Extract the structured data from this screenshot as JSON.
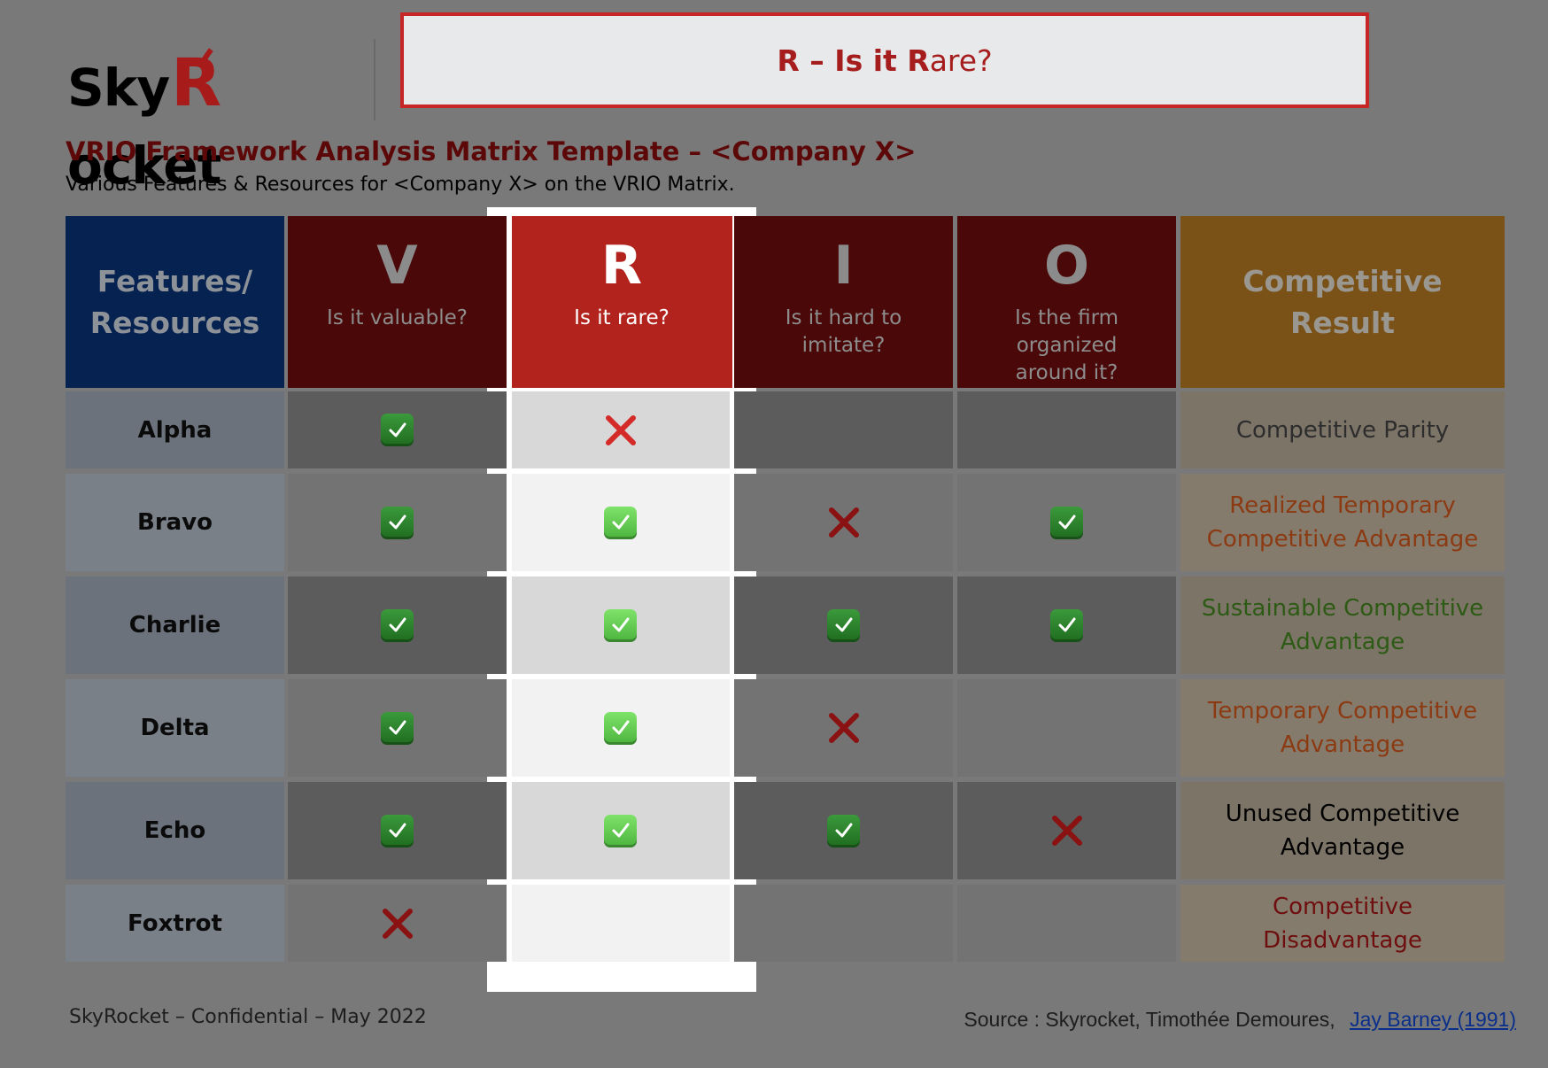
{
  "logo": {
    "pre": "Sky",
    "r": "R",
    "post": "ocket"
  },
  "banner": {
    "part1": "R",
    "part2": " – Is it ",
    "part3": "R",
    "part4": "are?"
  },
  "title": "VRIO Framework Analysis Matrix Template – <Company X>",
  "subtitle": "Various Features & Resources for <Company X> on the VRIO Matrix.",
  "header": {
    "features": [
      "Features/",
      "Resources"
    ],
    "columns": [
      {
        "letter": "V",
        "question": "Is it valuable?"
      },
      {
        "letter": "R",
        "question": "Is it rare?"
      },
      {
        "letter": "I",
        "question": "Is it hard to imitate?"
      },
      {
        "letter": "O",
        "question": "Is the firm organized around it?"
      }
    ],
    "result": [
      "Competitive",
      "Result"
    ]
  },
  "rows": [
    {
      "label": "Alpha",
      "marks": [
        "check",
        "cross",
        "",
        ""
      ],
      "result": "Competitive Parity",
      "result_color": "#2d2d2d"
    },
    {
      "label": "Bravo",
      "marks": [
        "check",
        "check",
        "cross",
        "check"
      ],
      "result": "Realized Temporary Competitive Advantage",
      "result_color": "#8b3a12"
    },
    {
      "label": "Charlie",
      "marks": [
        "check",
        "check",
        "check",
        "check"
      ],
      "result": "Sustainable Competitive Advantage",
      "result_color": "#2d5a14"
    },
    {
      "label": "Delta",
      "marks": [
        "check",
        "check",
        "cross",
        ""
      ],
      "result": "Temporary Competitive Advantage",
      "result_color": "#8b3a12"
    },
    {
      "label": "Echo",
      "marks": [
        "check",
        "check",
        "check",
        "cross"
      ],
      "result": "Unused Competitive Advantage",
      "result_color": "#000000"
    },
    {
      "label": "Foxtrot",
      "marks": [
        "cross",
        "",
        "",
        ""
      ],
      "result": "Competitive Disadvantage",
      "result_color": "#6e0e0e"
    }
  ],
  "footer": {
    "left": "SkyRocket – Confidential – May 2022",
    "source_text": "Source : Skyrocket, Timothée Demoures,",
    "source_link": "Jay Barney (1991)"
  },
  "colors": {
    "features_header": "#062251",
    "vrio_header": "#4b0808",
    "rare_header": "#b2231d",
    "result_header": "#7a5217",
    "check_green": "#2f852f",
    "cross_red": "#8b1212",
    "cross_bright": "#d42b28"
  }
}
